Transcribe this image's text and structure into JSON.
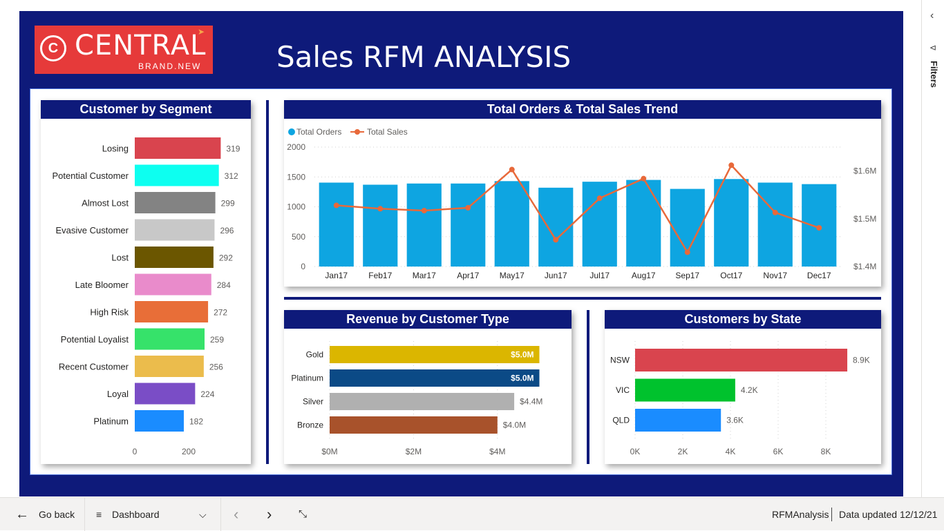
{
  "header": {
    "logo_word": "CENTRAL",
    "logo_sub": "BRAND.NEW",
    "title": "Sales RFM ANALYSIS"
  },
  "segment_card": {
    "title": "Customer by Segment",
    "axis_ticks": [
      "0",
      "200"
    ],
    "bar_color_list": [
      "#d9444e",
      "#0dfff0",
      "#838383",
      "#c8c8c8",
      "#6b5600",
      "#e98bcb",
      "#e86e38",
      "#36e26a",
      "#ebbc4c",
      "#7a4dc6",
      "#1a8cff"
    ]
  },
  "trend_card": {
    "title": "Total Orders & Total Sales Trend",
    "legend_orders": "Total Orders",
    "legend_sales": "Total Sales",
    "left_ticks": [
      "2000",
      "1500",
      "1000",
      "500",
      "0"
    ],
    "right_ticks": [
      "$1.6M",
      "$1.5M",
      "$1.4M"
    ],
    "orders_color": "#0ea5e1",
    "sales_color": "#e8693a"
  },
  "revenue_card": {
    "title": "Revenue by Customer Type",
    "axis_ticks": [
      "$0M",
      "$2M",
      "$4M"
    ],
    "bar_color_list": [
      "#dbb600",
      "#0b4a86",
      "#b0b0b0",
      "#a8522b"
    ]
  },
  "state_card": {
    "title": "Customers by State",
    "axis_ticks": [
      "0K",
      "2K",
      "4K",
      "6K",
      "8K"
    ],
    "bar_color_list": [
      "#d9444e",
      "#00c22d",
      "#1a8cff"
    ]
  },
  "chart_data": [
    {
      "type": "bar",
      "orientation": "horizontal",
      "title": "Customer by Segment",
      "categories": [
        "Losing",
        "Potential Customer",
        "Almost Lost",
        "Evasive Customer",
        "Lost",
        "Late Bloomer",
        "High Risk",
        "Potential Loyalist",
        "Recent Customer",
        "Loyal",
        "Platinum"
      ],
      "values": [
        319,
        312,
        299,
        296,
        292,
        284,
        272,
        259,
        256,
        224,
        182
      ],
      "labels": [
        "319",
        "312",
        "299",
        "296",
        "292",
        "284",
        "272",
        "259",
        "256",
        "224",
        "182"
      ],
      "xlim": [
        0,
        320
      ]
    },
    {
      "type": "bar",
      "title": "Total Orders & Total Sales Trend",
      "categories": [
        "Jan17",
        "Feb17",
        "Mar17",
        "Apr17",
        "May17",
        "Jun17",
        "Jul17",
        "Aug17",
        "Sep17",
        "Oct17",
        "Nov17",
        "Dec17"
      ],
      "series": [
        {
          "name": "Total Orders",
          "type": "bar",
          "axis": "left",
          "values": [
            1405,
            1370,
            1390,
            1390,
            1430,
            1320,
            1420,
            1450,
            1300,
            1465,
            1405,
            1380
          ]
        },
        {
          "name": "Total Sales",
          "type": "line",
          "axis": "right",
          "values": [
            1.528,
            1.521,
            1.517,
            1.523,
            1.603,
            1.456,
            1.543,
            1.584,
            1.43,
            1.612,
            1.513,
            1.481
          ]
        }
      ],
      "ylim_left": [
        0,
        2000
      ],
      "ylim_right": [
        1.4,
        1.65
      ],
      "legend": "top-left"
    },
    {
      "type": "bar",
      "orientation": "horizontal",
      "title": "Revenue by Customer Type",
      "categories": [
        "Gold",
        "Platinum",
        "Silver",
        "Bronze"
      ],
      "values": [
        5.0,
        5.0,
        4.4,
        4.0
      ],
      "labels": [
        "$5.0M",
        "$5.0M",
        "$4.4M",
        "$4.0M"
      ],
      "xlim": [
        0,
        5.2
      ]
    },
    {
      "type": "bar",
      "orientation": "horizontal",
      "title": "Customers by State",
      "categories": [
        "NSW",
        "VIC",
        "QLD"
      ],
      "values": [
        8.9,
        4.2,
        3.6
      ],
      "labels": [
        "8.9K",
        "4.2K",
        "3.6K"
      ],
      "xlim": [
        0,
        9
      ]
    }
  ],
  "bottombar": {
    "back_label": "Go back",
    "page_label": "Dashboard",
    "report_name": "RFMAnalysis",
    "updated": "Data updated 12/12/21"
  },
  "rightpane": {
    "filters_label": "Filters"
  }
}
